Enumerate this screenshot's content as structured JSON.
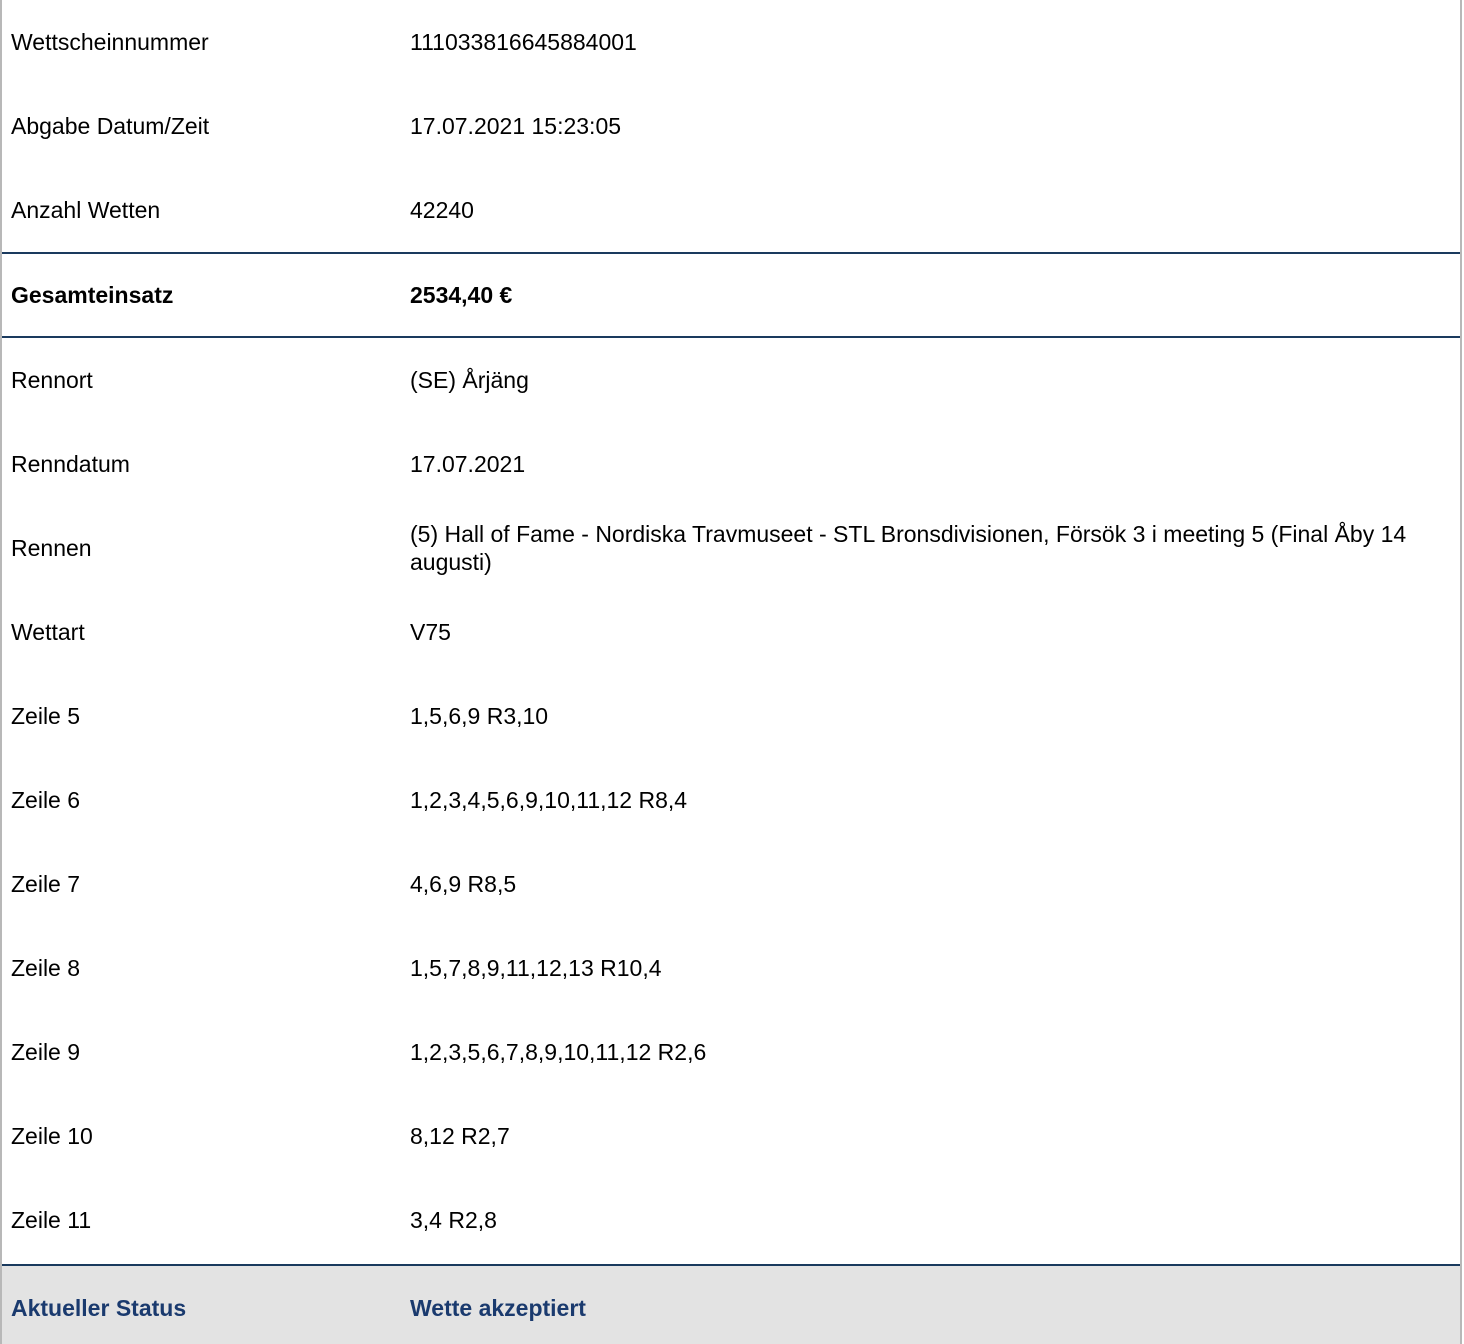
{
  "ticket": {
    "rows_top": [
      {
        "label": "Wettscheinnummer",
        "value": "111033816645884001"
      },
      {
        "label": "Abgabe Datum/Zeit",
        "value": "17.07.2021 15:23:05"
      },
      {
        "label": "Anzahl Wetten",
        "value": "42240"
      }
    ],
    "total": {
      "label": "Gesamteinsatz",
      "value": "2534,40 €"
    },
    "rows_detail": [
      {
        "label": "Rennort",
        "value": "(SE) Årjäng"
      },
      {
        "label": "Renndatum",
        "value": "17.07.2021"
      },
      {
        "label": "Rennen",
        "value": "(5) Hall of Fame - Nordiska Travmuseet - STL Bronsdivisionen, Försök 3 i meeting 5 (Final Åby 14 augusti)"
      },
      {
        "label": "Wettart",
        "value": "V75"
      },
      {
        "label": "Zeile 5",
        "value": "1,5,6,9 R3,10"
      },
      {
        "label": "Zeile 6",
        "value": "1,2,3,4,5,6,9,10,11,12 R8,4"
      },
      {
        "label": "Zeile 7",
        "value": "4,6,9 R8,5"
      },
      {
        "label": "Zeile 8",
        "value": "1,5,7,8,9,11,12,13 R10,4"
      },
      {
        "label": "Zeile 9",
        "value": "1,2,3,5,6,7,8,9,10,11,12 R2,6"
      },
      {
        "label": "Zeile 10",
        "value": "8,12 R2,7"
      },
      {
        "label": "Zeile 11",
        "value": "3,4 R2,8"
      }
    ],
    "status": {
      "label": "Aktueller Status",
      "value": "Wette akzeptiert"
    }
  },
  "colors": {
    "accent_line": "#1a3a5e",
    "status_text": "#1a3a6e",
    "status_background": "#e3e3e3"
  }
}
